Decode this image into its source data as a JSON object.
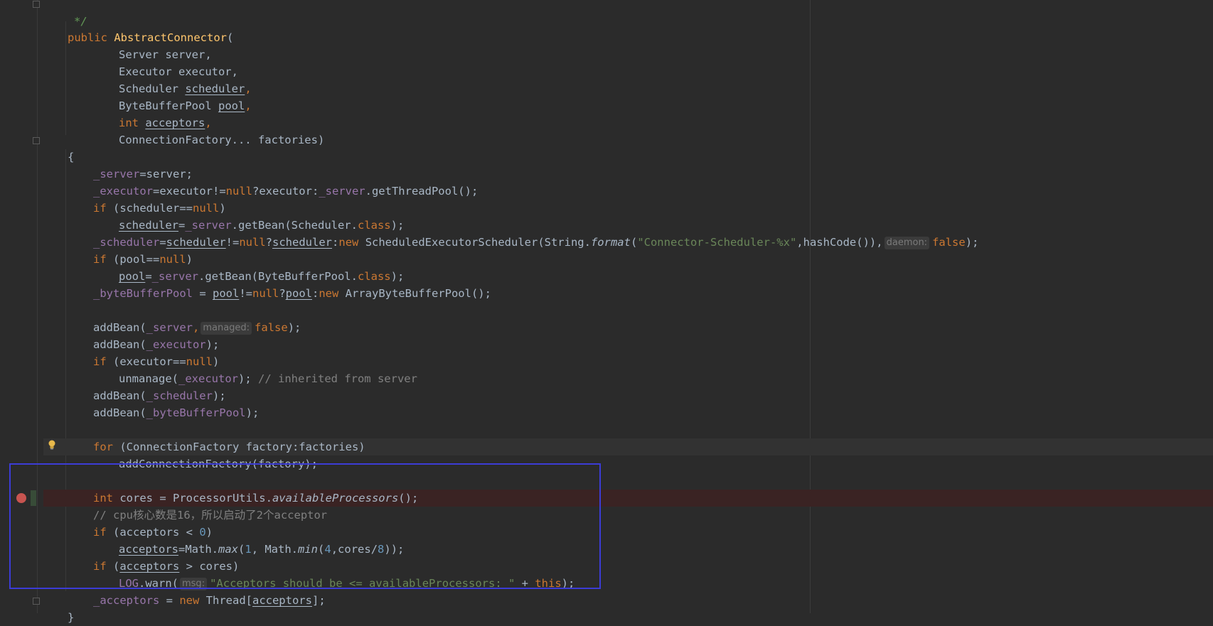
{
  "editor": {
    "lines": {
      "l0": "*/",
      "l1_kw": "public",
      "l1_name": "AbstractConnector",
      "l1_paren": "(",
      "l2": "Server server,",
      "l3": "Executor executor,",
      "l4_type": "Scheduler ",
      "l4_var": "scheduler",
      "l5_type": "ByteBufferPool ",
      "l5_var": "pool",
      "l6_kw": "int ",
      "l6_var": "acceptors",
      "l7": "ConnectionFactory... factories)",
      "l8": "{",
      "l9_field": "_server",
      "l9_rest": "=server;",
      "l10_field": "_executor",
      "l10_a": "=executor!=",
      "l10_null": "null",
      "l10_b": "?executor:",
      "l10_field2": "_server",
      "l10_c": ".getThreadPool();",
      "l11_if": "if",
      "l11_a": " (scheduler==",
      "l11_null": "null",
      "l11_b": ")",
      "l12_var": "scheduler",
      "l12_a": "=",
      "l12_field": "_server",
      "l12_b": ".getBean(Scheduler.",
      "l12_kw": "class",
      "l12_c": ");",
      "l13_field": "_scheduler",
      "l13_a": "=",
      "l13_var": "scheduler",
      "l13_b": "!=",
      "l13_null": "null",
      "l13_c": "?",
      "l13_var2": "scheduler",
      "l13_d": ":",
      "l13_new": "new ",
      "l13_e": "ScheduledExecutorScheduler(String.",
      "l13_fmt": "format",
      "l13_f": "(",
      "l13_str": "\"Connector-Scheduler-%x\"",
      "l13_g": ",hashCode()),",
      "l13_hint": "daemon:",
      "l13_false": "false",
      "l13_h": ");",
      "l14_if": "if",
      "l14_a": " (pool==",
      "l14_null": "null",
      "l14_b": ")",
      "l15_var": "pool",
      "l15_a": "=",
      "l15_field": "_server",
      "l15_b": ".getBean(ByteBufferPool.",
      "l15_kw": "class",
      "l15_c": ");",
      "l16_field": "_byteBufferPool",
      "l16_a": " = ",
      "l16_var": "pool",
      "l16_b": "!=",
      "l16_null": "null",
      "l16_c": "?",
      "l16_var2": "pool",
      "l16_d": ":",
      "l16_new": "new ",
      "l16_e": "ArrayByteBufferPool();",
      "l18_a": "addBean(",
      "l18_field": "_server",
      "l18_b": ",",
      "l18_hint": "managed:",
      "l18_false": "false",
      "l18_c": ");",
      "l19_a": "addBean(",
      "l19_field": "_executor",
      "l19_b": ");",
      "l20_if": "if",
      "l20_a": " (executor==",
      "l20_null": "null",
      "l20_b": ")",
      "l21_a": "unmanage(",
      "l21_field": "_executor",
      "l21_b": ");",
      "l21_cmt": " // inherited from server",
      "l22_a": "addBean(",
      "l22_field": "_scheduler",
      "l22_b": ");",
      "l23_a": "addBean(",
      "l23_field": "_byteBufferPool",
      "l23_b": ");",
      "l25_for": "for",
      "l25_a": " (ConnectionFactory factory:factories)",
      "l26": "addConnectionFactory(factory);",
      "l28_int": "int ",
      "l28_a": "cores = ProcessorUtils.",
      "l28_m": "availableProcessors",
      "l28_b": "();",
      "l29_cmt": "// cpu核心数是16，所以启动了2个acceptor",
      "l30_if": "if",
      "l30_a": " (acceptors < ",
      "l30_num": "0",
      "l30_b": ")",
      "l31_var": "acceptors",
      "l31_a": "=Math.",
      "l31_max": "max",
      "l31_b": "(",
      "l31_n1": "1",
      "l31_c": ", Math.",
      "l31_min": "min",
      "l31_d": "(",
      "l31_n4": "4",
      "l31_e": ",cores/",
      "l31_n8": "8",
      "l31_f": "));",
      "l32_if": "if",
      "l32_a": " (",
      "l32_var": "acceptors",
      "l32_b": " > cores)",
      "l33_log": "LOG",
      "l33_a": ".warn(",
      "l33_hint": "msg:",
      "l33_str": "\"Acceptors should be <= availableProcessors: \"",
      "l33_b": " + ",
      "l33_this": "this",
      "l33_c": ");",
      "l34_field": "_acceptors",
      "l34_a": " = ",
      "l34_new": "new ",
      "l34_b": "Thread[",
      "l34_var": "acceptors",
      "l34_c": "];",
      "l35": "}"
    },
    "colors": {
      "background": "#2b2b2b",
      "keyword": "#cc7832",
      "field": "#9876aa",
      "string": "#6a8759",
      "number": "#6897bb",
      "comment": "#808080",
      "method_decl": "#ffc66d",
      "highlight_box": "#3c3cd6",
      "breakpoint": "#c75450"
    },
    "icons": {
      "breakpoint": "breakpoint-icon",
      "bulb": "lightbulb-icon",
      "fold": "fold-marker-icon"
    }
  }
}
